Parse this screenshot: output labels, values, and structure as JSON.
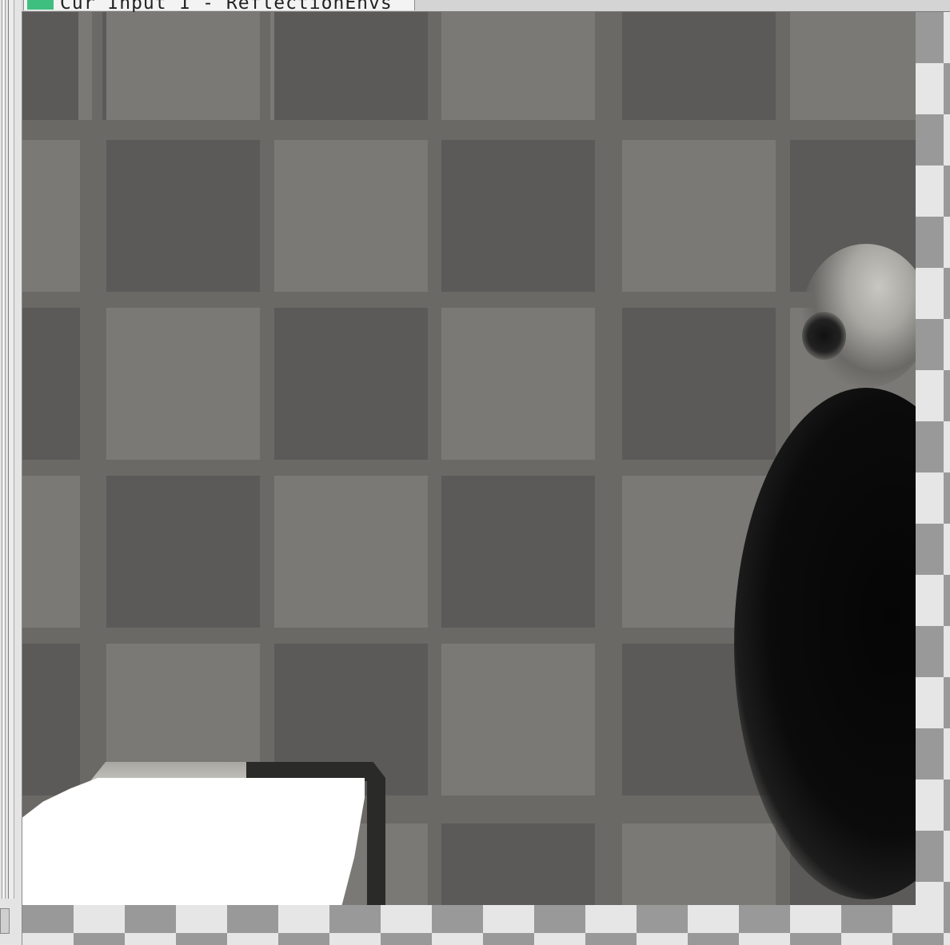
{
  "window": {
    "tab_title": "Cur Input 1 - ReflectionEnvs",
    "tab_icon": "green-square-icon",
    "tab_icon_color": "#3fbf7f"
  },
  "viewport": {
    "background": "transparency-checkerboard",
    "image_description_colors": {
      "light_tile": "#7a7975",
      "dark_tile": "#5b5a58",
      "grout": "#6a6966"
    }
  }
}
